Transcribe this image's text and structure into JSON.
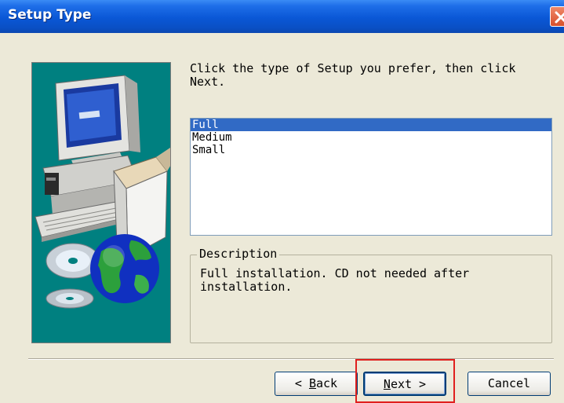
{
  "window": {
    "title": "Setup Type"
  },
  "prompt": "Click the type of Setup you prefer, then click\nNext.",
  "setup_types": {
    "items": [
      "Full",
      "Medium",
      "Small"
    ],
    "selected_index": 0
  },
  "description": {
    "legend": "Description",
    "text": "Full installation. CD not needed after\ninstallation."
  },
  "buttons": {
    "back": {
      "prefix": "< ",
      "mnemonic": "B",
      "rest": "ack"
    },
    "next": {
      "mnemonic": "N",
      "rest": "ext >"
    },
    "cancel": "Cancel"
  },
  "colors": {
    "titlebar": "#0a57d6",
    "selection": "#316ac5",
    "art_background": "#008080",
    "highlight": "#e0201e"
  }
}
